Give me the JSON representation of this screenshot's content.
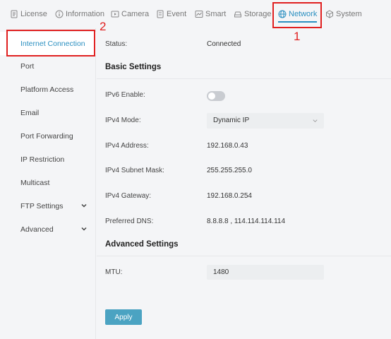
{
  "tabs": [
    {
      "label": "License",
      "icon": "license-icon"
    },
    {
      "label": "Information",
      "icon": "info-icon"
    },
    {
      "label": "Camera",
      "icon": "camera-icon"
    },
    {
      "label": "Event",
      "icon": "event-icon"
    },
    {
      "label": "Smart",
      "icon": "smart-icon"
    },
    {
      "label": "Storage",
      "icon": "storage-icon"
    },
    {
      "label": "Network",
      "icon": "globe-icon",
      "active": true
    },
    {
      "label": "System",
      "icon": "system-icon"
    }
  ],
  "sidebar": {
    "items": [
      {
        "label": "Internet Connection",
        "active": true
      },
      {
        "label": "Port"
      },
      {
        "label": "Platform Access"
      },
      {
        "label": "Email"
      },
      {
        "label": "Port Forwarding"
      },
      {
        "label": "IP Restriction"
      },
      {
        "label": "Multicast"
      },
      {
        "label": "FTP Settings",
        "expandable": true
      },
      {
        "label": "Advanced",
        "expandable": true
      }
    ]
  },
  "main": {
    "status_label": "Status",
    "status_value": "Connected",
    "basic_title": "Basic Settings",
    "ipv6_label": "IPv6 Enable",
    "ipv6_enabled": false,
    "ipv4_mode_label": "IPv4 Mode",
    "ipv4_mode_value": "Dynamic IP",
    "ipv4_address_label": "IPv4 Address",
    "ipv4_address_value": "192.168.0.43",
    "subnet_label": "IPv4 Subnet Mask",
    "subnet_value": "255.255.255.0",
    "gateway_label": "IPv4 Gateway",
    "gateway_value": "192.168.0.254",
    "dns_label": "Preferred DNS",
    "dns_value": "8.8.8.8 , 114.114.114.114",
    "advanced_title": "Advanced Settings",
    "mtu_label": "MTU",
    "mtu_value": "1480",
    "apply_label": "Apply"
  },
  "annotations": {
    "step1": "1",
    "step2": "2",
    "color": "#e02020"
  },
  "colors": {
    "accent": "#2a8fc0",
    "button": "#4ba3c2"
  }
}
